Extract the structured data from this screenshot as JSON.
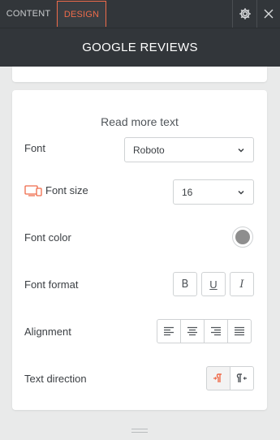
{
  "tabs": [
    {
      "label": "CONTENT",
      "active": false
    },
    {
      "label": "DESIGN",
      "active": true
    }
  ],
  "toolbar": {
    "settings_icon": "gear-icon",
    "close_icon": "close-icon"
  },
  "header": {
    "title": "GOOGLE REVIEWS"
  },
  "section": {
    "title": "Read more text",
    "font": {
      "label": "Font",
      "value": "Roboto"
    },
    "font_size": {
      "label": "Font size",
      "value": "16",
      "icon": "device-desktop-mobile-icon"
    },
    "font_color": {
      "label": "Font color",
      "color": "#8e8e8e"
    },
    "font_format": {
      "label": "Font format",
      "buttons": [
        "B",
        "U",
        "I"
      ]
    },
    "alignment": {
      "label": "Alignment",
      "options": [
        "align-left",
        "align-center",
        "align-right",
        "align-justify"
      ]
    },
    "text_direction": {
      "label": "Text direction",
      "options": [
        "ltr",
        "rtl"
      ],
      "selected": "ltr"
    }
  },
  "colors": {
    "accent": "#ef6b4a",
    "dark": "#32363a"
  }
}
